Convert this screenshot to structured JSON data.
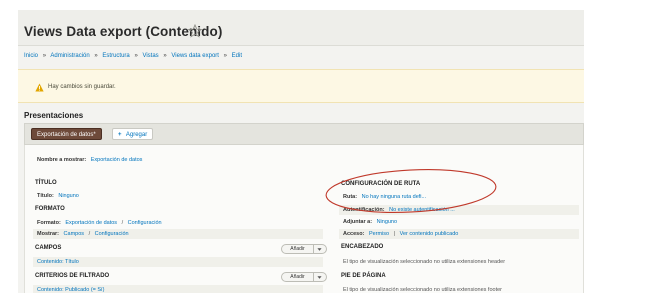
{
  "page": {
    "title": "Views Data export (Contenido)",
    "breadcrumb": [
      "Inicio",
      "Administración",
      "Estructura",
      "Vistas",
      "Views data export",
      "Edit"
    ],
    "breadcrumb_sep": "»"
  },
  "warning": {
    "text": "Hay cambios sin guardar."
  },
  "displays": {
    "section_title": "Presentaciones",
    "active_tab": "Exportación de datos*",
    "add_label": "Agregar",
    "add_plus": "+"
  },
  "display_name": {
    "label": "Nombre a mostrar:",
    "value": "Exportación de datos"
  },
  "left": {
    "title_heading": "TÍTULO",
    "title_label": "Título:",
    "title_value": "Ninguno",
    "format_heading": "FORMATO",
    "format_label": "Formato:",
    "format_value": "Exportación de datos",
    "format_settings": "Configuración",
    "show_label": "Mostrar:",
    "show_value": "Campos",
    "show_settings": "Configuración",
    "link_sep": "/",
    "fields_heading": "CAMPOS",
    "fields_item": "Contenido: Título",
    "filters_heading": "CRITERIOS DE FILTRADO",
    "filters_item": "Contenido: Publicado (= Sí)",
    "add_button": "Añadir"
  },
  "right": {
    "route_heading": "CONFIGURACIÓN DE RUTA",
    "route_label": "Ruta:",
    "route_value": "No hay ninguna ruta defi...",
    "auth_label": "Autentificación:",
    "auth_value": "No existe autentificación ...",
    "attach_label": "Adjuntar a:",
    "attach_value": "Ninguno",
    "access_label": "Acceso:",
    "access_value": "Permiso",
    "access_sep": "|",
    "access_value2": "Ver contenido publicado",
    "header_heading": "ENCABEZADO",
    "header_text": "El tipo de visualización seleccionado no utiliza extensiones header",
    "footer_heading": "PIE DE PÁGINA",
    "footer_text": "El tipo de visualización seleccionado no utiliza extensiones footer"
  },
  "colors": {
    "link": "#0074bd",
    "active_tab": "#6e4a3a",
    "warning_bg": "#fdf8e4",
    "annotation": "#c0392b"
  },
  "icons": [
    "star-icon",
    "warning-icon",
    "chevron-down-icon"
  ]
}
